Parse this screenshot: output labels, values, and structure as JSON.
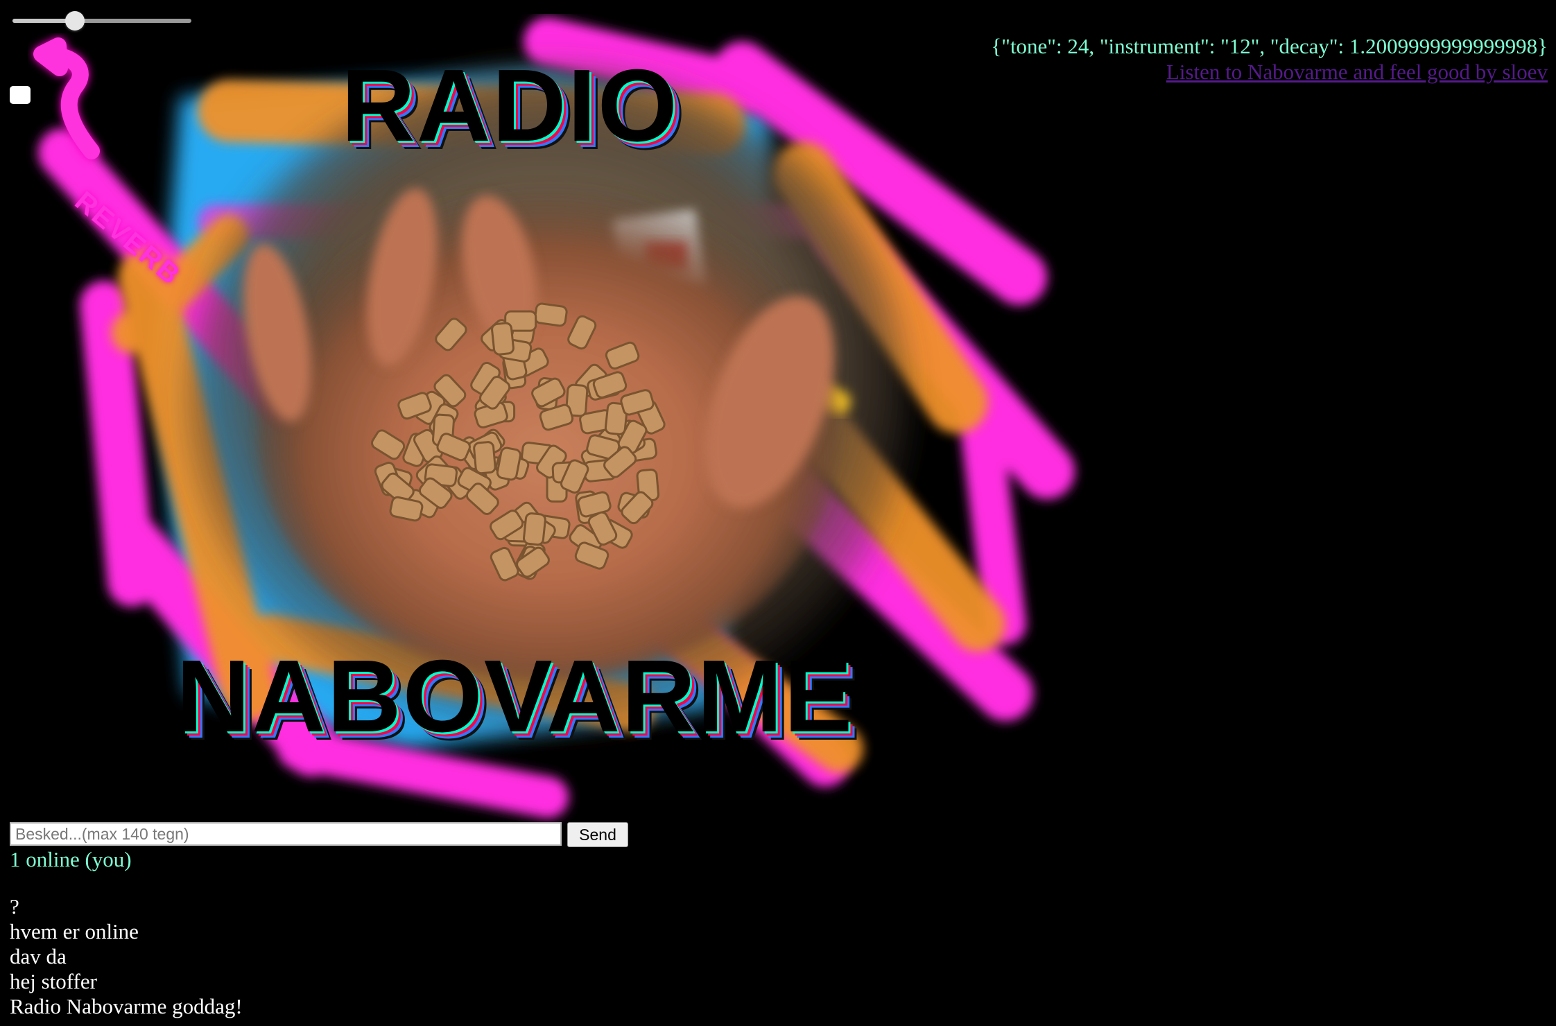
{
  "controls": {
    "reverb_slider_value": 0.35,
    "reverb_label": "REVERB",
    "toggle_checked": false
  },
  "header": {
    "params_text": "{\"tone\": 24, \"instrument\": \"12\", \"decay\": 1.2009999999999998}",
    "stream_link_label": "Listen to Nabovarme and feel good by sloev"
  },
  "poster": {
    "title_line1": "RADIO",
    "title_line2": "NABOVARME",
    "colors": {
      "magenta": "#ff2ee0",
      "orange": "#f0922a",
      "cyan": "#2ab4ff"
    }
  },
  "chat": {
    "input_placeholder": "Besked...(max 140 tegn)",
    "input_value": "",
    "send_label": "Send",
    "online_status": "1 online (you)",
    "messages": [
      "?",
      "hvem er online",
      "dav da",
      "hej stoffer",
      "Radio Nabovarme goddag!"
    ]
  }
}
